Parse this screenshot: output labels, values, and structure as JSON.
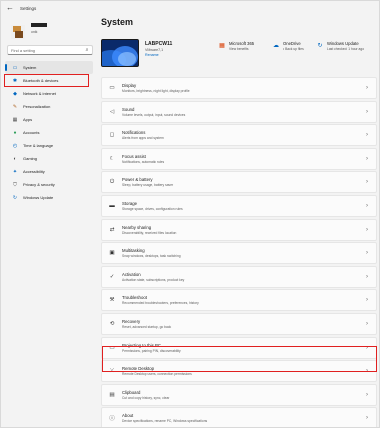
{
  "window": {
    "title": "Settings",
    "back_icon": "back-arrow-icon"
  },
  "profile": {
    "email": "onik"
  },
  "search": {
    "placeholder": "Find a setting"
  },
  "sidebar": {
    "items": [
      {
        "label": "System",
        "icon": "monitor-icon",
        "glyph": "▭",
        "color": "#0067c0",
        "active": true
      },
      {
        "label": "Bluetooth & devices",
        "icon": "bluetooth-icon",
        "glyph": "✱",
        "color": "#0067c0"
      },
      {
        "label": "Network & internet",
        "icon": "wifi-icon",
        "glyph": "◆",
        "color": "#0067c0"
      },
      {
        "label": "Personalization",
        "icon": "brush-icon",
        "glyph": "✎",
        "color": "#b06a2c"
      },
      {
        "label": "Apps",
        "icon": "apps-icon",
        "glyph": "▦",
        "color": "#4a4a4a"
      },
      {
        "label": "Accounts",
        "icon": "person-icon",
        "glyph": "●",
        "color": "#2e9e5a"
      },
      {
        "label": "Time & language",
        "icon": "clock-icon",
        "glyph": "◴",
        "color": "#0067c0"
      },
      {
        "label": "Gaming",
        "icon": "gamepad-icon",
        "glyph": "◐",
        "color": "#4a4a4a"
      },
      {
        "label": "Accessibility",
        "icon": "accessibility-icon",
        "glyph": "✦",
        "color": "#0067c0"
      },
      {
        "label": "Privacy & security",
        "icon": "shield-icon",
        "glyph": "⛉",
        "color": "#4a4a4a"
      },
      {
        "label": "Windows Update",
        "icon": "update-icon",
        "glyph": "↻",
        "color": "#0067c0"
      }
    ]
  },
  "main": {
    "title": "System",
    "device": {
      "name": "LABPCW11",
      "model": "VMware7,1",
      "rename": "Rename"
    },
    "quick": [
      {
        "title": "Microsoft 365",
        "sub": "View benefits",
        "icon": "microsoft-logo-icon",
        "glyph": "▦",
        "color": "#d83b01"
      },
      {
        "title": "OneDrive",
        "sub": "• Back up files",
        "icon": "cloud-icon",
        "glyph": "☁",
        "color": "#0067c0"
      },
      {
        "title": "Windows Update",
        "sub": "Last checked: 1 hour ago",
        "icon": "update-icon",
        "glyph": "↻",
        "color": "#0067c0"
      }
    ],
    "settings": [
      {
        "key": "display",
        "title": "Display",
        "desc": "Monitors, brightness, night light, display profile",
        "icon": "display-icon",
        "glyph": "▭"
      },
      {
        "key": "sound",
        "title": "Sound",
        "desc": "Volume levels, output, input, sound devices",
        "icon": "speaker-icon",
        "glyph": "◁"
      },
      {
        "key": "notifications",
        "title": "Notifications",
        "desc": "Alerts from apps and system",
        "icon": "bell-icon",
        "glyph": "◻"
      },
      {
        "key": "focus-assist",
        "title": "Focus assist",
        "desc": "Notifications, automatic rules",
        "icon": "moon-icon",
        "glyph": "☾"
      },
      {
        "key": "power-battery",
        "title": "Power & battery",
        "desc": "Sleep, battery usage, battery saver",
        "icon": "power-icon",
        "glyph": "⏻"
      },
      {
        "key": "storage",
        "title": "Storage",
        "desc": "Storage space, drives, configuration rules",
        "icon": "storage-icon",
        "glyph": "▬"
      },
      {
        "key": "nearby-sharing",
        "title": "Nearby sharing",
        "desc": "Discoverability, received files location",
        "icon": "share-icon",
        "glyph": "⇄"
      },
      {
        "key": "multitasking",
        "title": "Multitasking",
        "desc": "Snap windows, desktops, task switching",
        "icon": "multitask-icon",
        "glyph": "▣"
      },
      {
        "key": "activation",
        "title": "Activation",
        "desc": "Activation state, subscriptions, product key",
        "icon": "activation-icon",
        "glyph": "✓"
      },
      {
        "key": "troubleshoot",
        "title": "Troubleshoot",
        "desc": "Recommended troubleshooters, preferences, history",
        "icon": "wrench-icon",
        "glyph": "⚒"
      },
      {
        "key": "recovery",
        "title": "Recovery",
        "desc": "Reset, advanced startup, go back",
        "icon": "recovery-icon",
        "glyph": "⟲"
      },
      {
        "key": "projecting",
        "title": "Projecting to this PC",
        "desc": "Permissions, pairing PIN, discoverability",
        "icon": "projector-icon",
        "glyph": "▭"
      },
      {
        "key": "remote-desktop",
        "title": "Remote Desktop",
        "desc": "Remote Desktop users, connection permissions",
        "icon": "remote-desktop-icon",
        "glyph": "⤫"
      },
      {
        "key": "clipboard",
        "title": "Clipboard",
        "desc": "Cut and copy history, sync, clear",
        "icon": "clipboard-icon",
        "glyph": "▤"
      },
      {
        "key": "about",
        "title": "About",
        "desc": "Device specifications, rename PC, Windows specifications",
        "icon": "info-icon",
        "glyph": "ⓘ"
      }
    ],
    "chevron": "›"
  }
}
